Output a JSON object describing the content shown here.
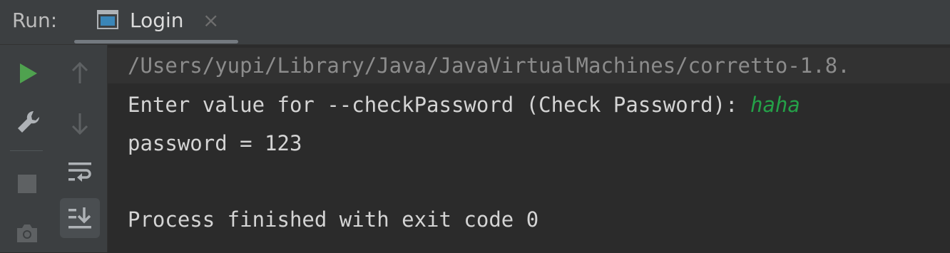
{
  "header": {
    "run_label": "Run:",
    "tab": {
      "label": "Login",
      "close": "×"
    }
  },
  "toolbar": {
    "left_tools": [
      {
        "name": "run-icon",
        "color": "#4fa24f"
      },
      {
        "name": "wrench-icon"
      },
      {
        "name": "stop-icon"
      },
      {
        "name": "camera-icon"
      }
    ],
    "right_tools": [
      {
        "name": "up-arrow-icon"
      },
      {
        "name": "down-arrow-icon"
      },
      {
        "name": "soft-wrap-icon"
      },
      {
        "name": "scroll-to-end-icon",
        "active": true
      }
    ]
  },
  "console": {
    "lines": [
      "/Users/yupi/Library/Java/JavaVirtualMachines/corretto-1.8.",
      "Enter value for --checkPassword (Check Password): ",
      "password = 123",
      "",
      "Process finished with exit code 0"
    ],
    "user_input": "haha",
    "colors": {
      "input": "#24a148",
      "path": "#8c8c8c",
      "text": "#d4d4d4"
    }
  }
}
